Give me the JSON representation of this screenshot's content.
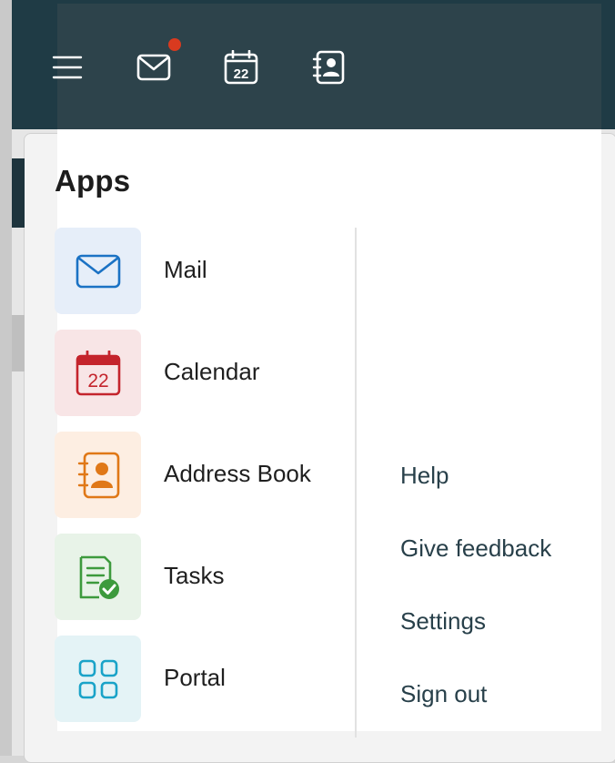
{
  "header": {
    "icons": [
      "menu-icon",
      "mail-icon",
      "calendar-icon",
      "address-book-icon"
    ],
    "calendar_day": "22",
    "notification_color": "#d93a1f",
    "background": "#2d434b"
  },
  "apps_title": "Apps",
  "apps": [
    {
      "label": "Mail",
      "icon": "mail-icon",
      "tile_color": "#e6eef9",
      "icon_color": "#1b72c4"
    },
    {
      "label": "Calendar",
      "icon": "calendar-icon",
      "day": "22",
      "tile_color": "#f8e5e6",
      "icon_color": "#c4242c"
    },
    {
      "label": "Address Book",
      "icon": "address-book-icon",
      "tile_color": "#fdeee2",
      "icon_color": "#e07817"
    },
    {
      "label": "Tasks",
      "icon": "tasks-icon",
      "tile_color": "#e8f3e8",
      "icon_color": "#3d9a3d"
    },
    {
      "label": "Portal",
      "icon": "portal-icon",
      "tile_color": "#e4f3f6",
      "icon_color": "#1aa3c8"
    }
  ],
  "links": [
    {
      "label": "Help"
    },
    {
      "label": "Give feedback"
    },
    {
      "label": "Settings"
    },
    {
      "label": "Sign out"
    }
  ]
}
